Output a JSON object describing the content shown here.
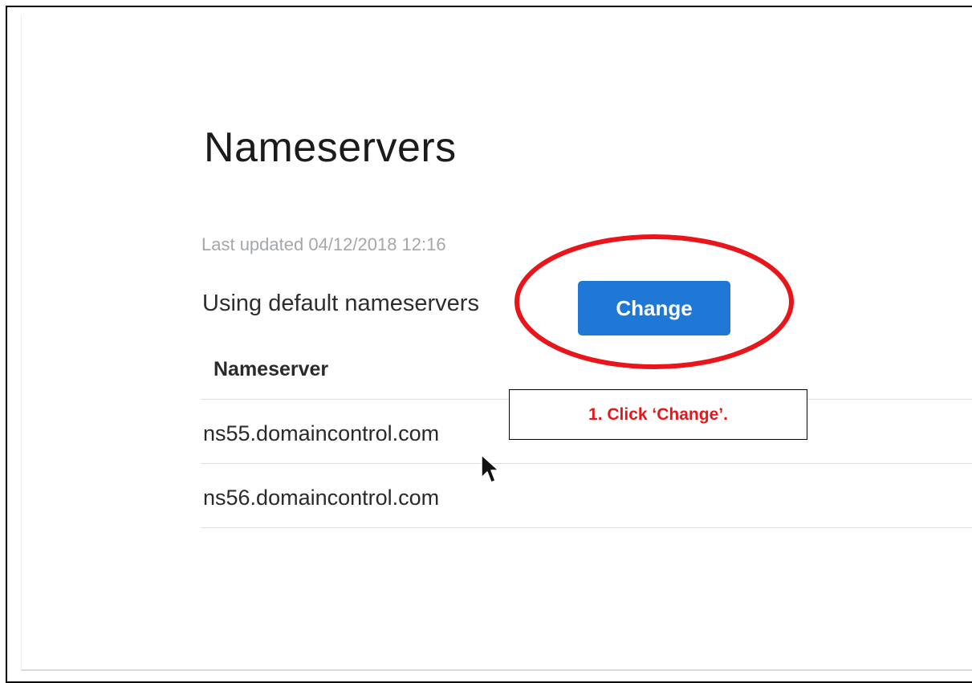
{
  "nameservers_panel": {
    "title": "Nameservers",
    "last_updated": "Last updated 04/12/2018 12:16",
    "status_text": "Using default nameservers",
    "change_button_label": "Change",
    "table": {
      "column_header": "Nameserver",
      "rows": [
        "ns55.domaincontrol.com",
        "ns56.domaincontrol.com"
      ]
    }
  },
  "annotation": {
    "instruction": "1.  Click ‘Change’.",
    "highlight_color": "#e8161b"
  },
  "colors": {
    "button_blue": "#1f78d6",
    "annotation_red": "#e8161b",
    "muted_text": "#a3a8ad"
  },
  "icons": {
    "cursor": "mouse-pointer-icon"
  }
}
